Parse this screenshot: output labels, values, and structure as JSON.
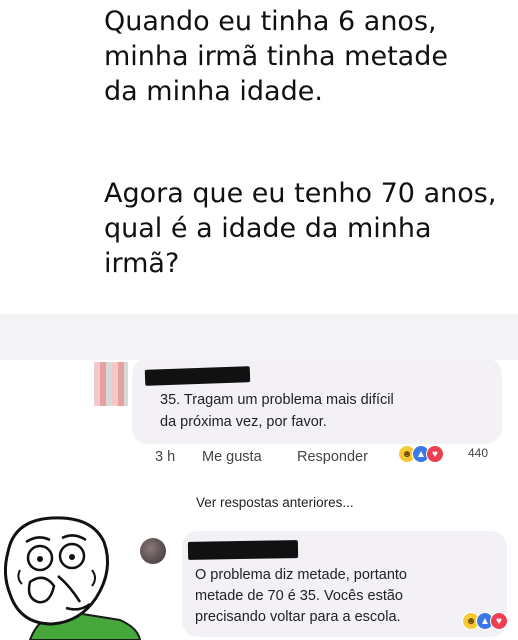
{
  "question": {
    "line1": "Quando eu tinha 6 anos,",
    "line2": "minha irmã tinha metade",
    "line3": "da minha idade.",
    "line4": "Agora que eu tenho 70 anos,",
    "line5": "qual é a idade da minha",
    "line6": "irmã?"
  },
  "comments": {
    "first": {
      "line1": "35. Tragam um problema mais difícil",
      "line2": "da próxima vez, por favor.",
      "time": "3 h",
      "like_label": "Me gusta",
      "reply_label": "Responder",
      "reaction_count": "440"
    },
    "view_previous_label": "Ver respostas anteriores...",
    "second": {
      "line1": "O problema diz metade, portanto",
      "line2": "metade de 70 é 35. Vocês estão",
      "line3": "precisando voltar para a escola."
    }
  },
  "colors": {
    "bubble": "#f3f1f6",
    "like": "#3b78e7",
    "love": "#ee3e52",
    "haha": "#f7c934"
  }
}
